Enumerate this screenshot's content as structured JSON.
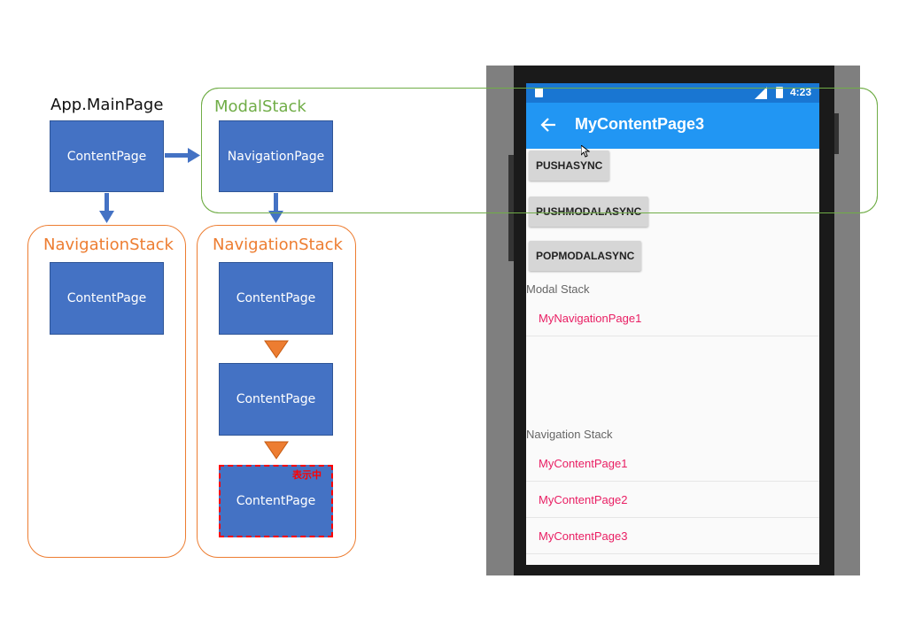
{
  "diagram": {
    "app_main_page_label": "App.MainPage",
    "modal_stack_label": "ModalStack",
    "nav_stack_left_label": "NavigationStack",
    "nav_stack_right_label": "NavigationStack",
    "main_content_page": "ContentPage",
    "navigation_page": "NavigationPage",
    "left_stack_page": "ContentPage",
    "right_stack_pages": [
      "ContentPage",
      "ContentPage",
      "ContentPage"
    ],
    "displaying_badge": "表示中",
    "colors": {
      "box_fill": "#4472c4",
      "orange": "#ed7d31",
      "green": "#70ad47",
      "arrow_blue": "#4472c4",
      "badge_red": "#ff0000"
    }
  },
  "phone": {
    "status_time": "4:23",
    "app_title": "MyContentPage3",
    "back_icon": "arrow-left-icon",
    "buttons": [
      "PUSHASYNC",
      "PUSHMODALASYNC",
      "POPMODALASYNC"
    ],
    "modal_stack_header": "Modal Stack",
    "modal_stack_items": [
      "MyNavigationPage1"
    ],
    "navigation_stack_header": "Navigation Stack",
    "navigation_stack_items": [
      "MyContentPage1",
      "MyContentPage2",
      "MyContentPage3"
    ],
    "colors": {
      "status_bar": "#1976d2",
      "app_bar": "#2196f3",
      "list_text": "#e91e63"
    }
  }
}
